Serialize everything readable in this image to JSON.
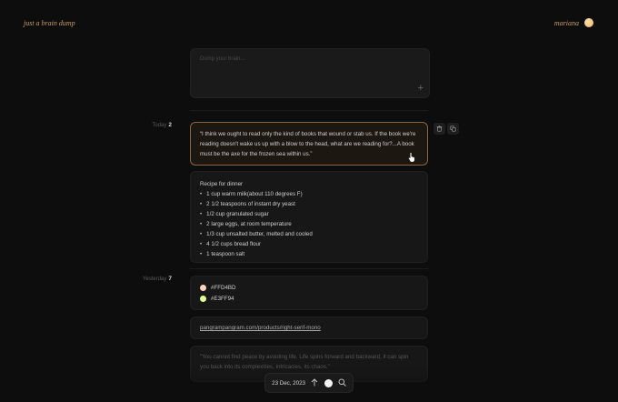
{
  "header": {
    "brand": "just a brain dump",
    "user_name": "mariana"
  },
  "composer": {
    "placeholder": "Dump your brain...",
    "add_icon": "plus-icon"
  },
  "groups": [
    {
      "label": "Today",
      "count": "2"
    },
    {
      "label": "Yesterday",
      "count": "7"
    }
  ],
  "entries": {
    "quote": "“I think we ought to read only the kind of books that wound or stab us. If the book we're reading doesn't wake us up with a blow to the head, what are we reading for?...A book must be the axe for the frozen sea within us.”",
    "recipe": {
      "title": "Recipe for dinner",
      "items": [
        "1 cup warm milk(about 110 degrees F)",
        "2 1/2 teaspoons of instant dry yeast",
        "1/2 cup granulated sugar",
        "2 large eggs, at room temperature",
        "1/3 cup unsalted butter, melted and cooled",
        "4 1/2 cups bread flour",
        "1 teaspoon salt"
      ]
    },
    "colors": [
      {
        "hex": "#FFD4BD",
        "label": "#FFD4BD"
      },
      {
        "hex": "#E3FF94",
        "label": "#E3FF94"
      }
    ],
    "link": "pangrampangram.com/products/right-serif-mono",
    "quote2": "\"You cannot find peace by avoiding life. Life spins forward and backward, it can spin you back into its complexities, intricacies, its chaos.\""
  },
  "card_actions": [
    "trash-icon",
    "copy-icon"
  ],
  "toolbar": {
    "date": "23 Dec, 2023"
  }
}
